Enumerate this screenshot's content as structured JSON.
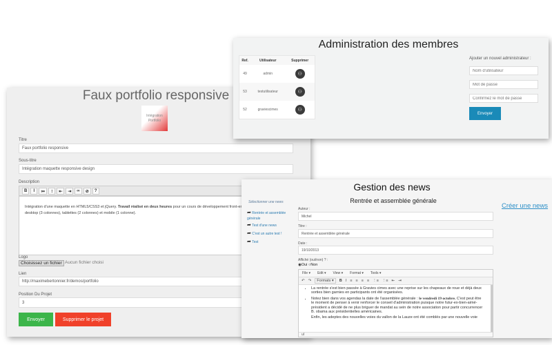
{
  "portfolio": {
    "title": "Faux portfolio responsive",
    "logo_text": [
      "Intégration",
      "Portfolio"
    ],
    "fields": {
      "titre": {
        "label": "Titre",
        "value": "Faux portfolio responsive"
      },
      "sous_titre": {
        "label": "Sous-titre",
        "value": "Intégration maquette responsive design"
      },
      "description": {
        "label": "Description",
        "text_a": "Intégration d'une maquette en HTML5/CSS3 et jQuery. ",
        "text_bold": "Travail réalisé en deux heures",
        "text_b": " pour un cours de développement front-end,",
        "text_c": "desktop (3 colonnes), tablettes (2 colonnes) et mobile (1 colonne)."
      },
      "logo": {
        "label": "Logo",
        "button": "Choisissez un fichier",
        "status": "Aucun fichier choisi"
      },
      "lien": {
        "label": "Lien",
        "value": "http://maximebertonnier.fr/demos/portfolio"
      },
      "position": {
        "label": "Position Du Projet",
        "value": "3"
      }
    },
    "toolbar": [
      "B",
      "I",
      "≔",
      "⁝",
      "⇤",
      "⇥",
      "∞",
      "⊘",
      "?"
    ],
    "submit": "Envoyer",
    "delete": "Supprimer le projet",
    "colors": {
      "submit": "#3cb54a",
      "delete": "#f0412a"
    }
  },
  "admin": {
    "title": "Administration des membres",
    "table": {
      "headers": [
        "Ref.",
        "Utilisateur",
        "Supprimer"
      ],
      "rows": [
        {
          "ref": "49",
          "user": "admin"
        },
        {
          "ref": "53",
          "user": "testutilisateur"
        },
        {
          "ref": "52",
          "user": "graviescimes"
        }
      ]
    },
    "add_label": "Ajouter un nouvel administrateur :",
    "placeholders": {
      "username": "Nom d'utilisateur",
      "password": "Mot de passe",
      "confirm": "Confirmez le mot de passe"
    },
    "submit": "Envoyer",
    "colors": {
      "submit": "#1a8ab8"
    }
  },
  "news": {
    "title": "Gestion des news",
    "subtitle": "Rentrée et assemblée générale",
    "create_link": "Créer une news",
    "select_label": "Sélectionner une news",
    "items": [
      "Rentrée et assemblée générale",
      "Test d'une news",
      "C'est un autre test !",
      "Test"
    ],
    "fields": {
      "auteur": {
        "label": "Auteur :",
        "value": "Michel"
      },
      "titre": {
        "label": "Titre :",
        "value": "Rentrée et assemblée générale"
      },
      "date": {
        "label": "Date :",
        "value": "19/10/2013"
      },
      "affiche": {
        "label": "Affiché (oui/non) ? :",
        "oui": "Oui",
        "non": "Non"
      }
    },
    "editor": {
      "menus": [
        "File ▾",
        "Edit ▾",
        "View ▾",
        "Format ▾",
        "Tools ▾"
      ],
      "formats": "Formats ▾",
      "p1": "La rentrée s'est bien passée à Gravies cimes avec une reprise sur les chapeaux de roue et déjà deux sorties bien garnies en participants ont été organisées.",
      "p2a": "Notez bien dans vos agendas la date de l'assemblée générale : ",
      "p2b": "le vendredi 19 octobre.",
      "p2c": " C'est peut être le moment de penser à venir renforcer le conseil d'administration puisque notre futur-ex-bien-aimé-président a décidé de ne plus briguer de mandat au sein de notre association pour partir concurrencer B. obama aux présidentielles américaines.",
      "p3": "Enfin, les adeptes des nouvelles voies du vallon de la Lauze ont été comblés par une nouvelle voie",
      "status": "ul"
    }
  }
}
